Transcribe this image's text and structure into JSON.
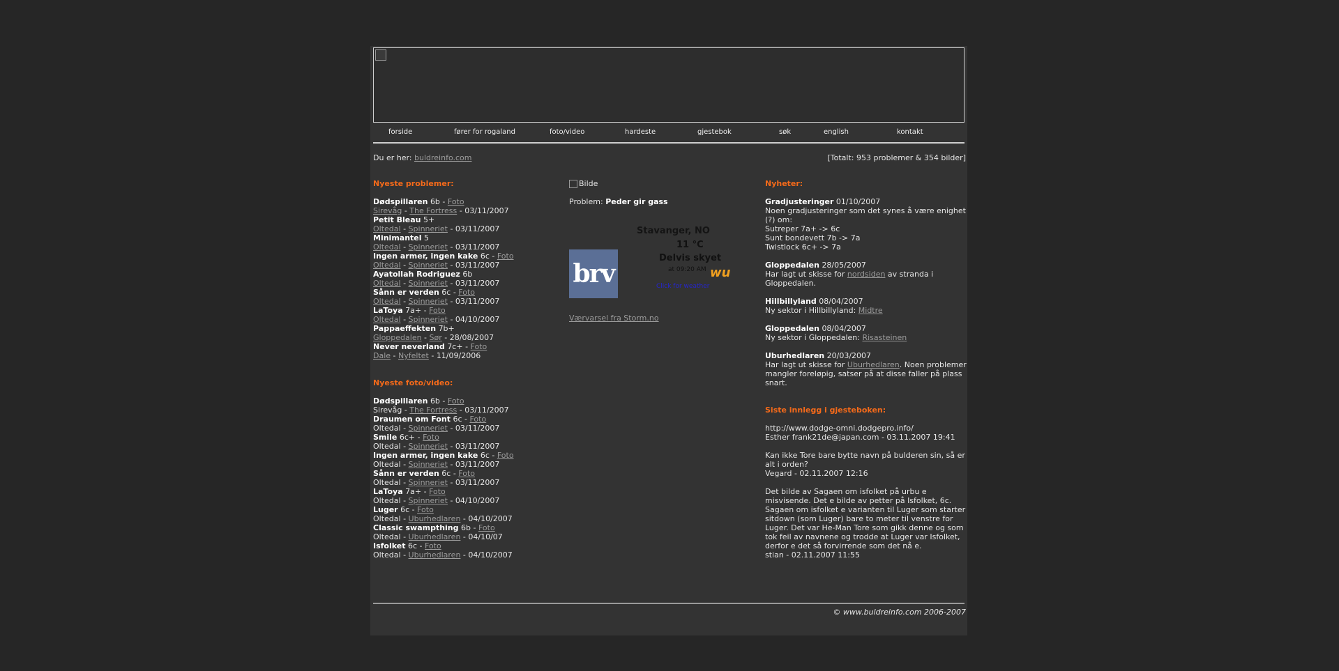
{
  "nav": [
    "forside",
    "fører for rogaland",
    "foto/video",
    "hardeste",
    "gjestebok",
    "søk",
    "english",
    "kontakt"
  ],
  "breadcrumb": {
    "prefix": "Du er her:",
    "link": "buldreinfo.com"
  },
  "totals": "[Totalt: 953 problemer & 354 bilder]",
  "newest_problems": {
    "heading": "Nyeste problemer:",
    "items": [
      {
        "name": "Dødspillaren",
        "grade": "6b",
        "foto": "Foto",
        "area": "Sirevåg",
        "sector": "The Fortress",
        "date": "03/11/2007"
      },
      {
        "name": "Petit Bleau",
        "grade": "5+",
        "foto": "",
        "area": "Oltedal",
        "sector": "Spinneriet",
        "date": "03/11/2007"
      },
      {
        "name": "Minimantel",
        "grade": "5",
        "foto": "",
        "area": "Oltedal",
        "sector": "Spinneriet",
        "date": "03/11/2007"
      },
      {
        "name": "Ingen armer, ingen kake",
        "grade": "6c",
        "foto": "Foto",
        "area": "Oltedal",
        "sector": "Spinneriet",
        "date": "03/11/2007"
      },
      {
        "name": "Ayatollah Rodriguez",
        "grade": "6b",
        "foto": "",
        "area": "Oltedal",
        "sector": "Spinneriet",
        "date": "03/11/2007"
      },
      {
        "name": "Sånn er verden",
        "grade": "6c",
        "foto": "Foto",
        "area": "Oltedal",
        "sector": "Spinneriet",
        "date": "03/11/2007"
      },
      {
        "name": "LaToya",
        "grade": "7a+",
        "foto": "Foto",
        "area": "Oltedal",
        "sector": "Spinneriet",
        "date": "04/10/2007"
      },
      {
        "name": "Pappaeffekten",
        "grade": "7b+",
        "foto": "",
        "area": "Gloppedalen",
        "sector": "Sør",
        "date": "28/08/2007"
      },
      {
        "name": "Never neverland",
        "grade": "7c+",
        "foto": "Foto",
        "area": "Dale",
        "sector": "Nyfeltet",
        "date": "11/09/2006"
      }
    ]
  },
  "newest_media": {
    "heading": "Nyeste foto/video:",
    "items": [
      {
        "name": "Dødspillaren",
        "grade": "6b",
        "foto": "Foto",
        "area": "Sirevåg",
        "sector": "The Fortress",
        "date": "03/11/2007"
      },
      {
        "name": "Draumen om Font",
        "grade": "6c",
        "foto": "Foto",
        "area": "Oltedal",
        "sector": "Spinneriet",
        "date": "03/11/2007"
      },
      {
        "name": "Smile",
        "grade": "6c+",
        "foto": "Foto",
        "area": "Oltedal",
        "sector": "Spinneriet",
        "date": "03/11/2007"
      },
      {
        "name": "Ingen armer, ingen kake",
        "grade": "6c",
        "foto": "Foto",
        "area": "Oltedal",
        "sector": "Spinneriet",
        "date": "03/11/2007"
      },
      {
        "name": "Sånn er verden",
        "grade": "6c",
        "foto": "Foto",
        "area": "Oltedal",
        "sector": "Spinneriet",
        "date": "03/11/2007"
      },
      {
        "name": "LaToya",
        "grade": "7a+",
        "foto": "Foto",
        "area": "Oltedal",
        "sector": "Spinneriet",
        "date": "04/10/2007"
      },
      {
        "name": "Luger",
        "grade": "6c",
        "foto": "Foto",
        "area": "Oltedal",
        "sector": "Uburhedlaren",
        "date": "04/10/2007"
      },
      {
        "name": "Classic swampthing",
        "grade": "6b",
        "foto": "Foto",
        "area": "Oltedal",
        "sector": "Uburhedlaren",
        "date": "04/10/07"
      },
      {
        "name": "Isfolket",
        "grade": "6c",
        "foto": "Foto",
        "area": "Oltedal",
        "sector": "Uburhedlaren",
        "date": "04/10/2007"
      }
    ]
  },
  "featured": {
    "image_alt": "Bilde",
    "problem_label": "Problem:",
    "problem_name": "Peder gir gass"
  },
  "weather": {
    "brv_logo": "brv",
    "city": "Stavanger, NO",
    "temp": "11 °C",
    "condition": "Delvis skyet",
    "time": "at 09:20 AM",
    "logo": "wu",
    "link": "Click for weather",
    "storm_link": "Værvarsel fra Storm.no"
  },
  "news": {
    "heading": "Nyheter:",
    "items": [
      {
        "title": "Gradjusteringer",
        "date": "01/10/2007",
        "lines": [
          "Noen gradjusteringer som det synes å være enighet (?) om:",
          "Sutreper 7a+ -> 6c",
          "Sunt bondevett 7b -> 7a",
          "Twistlock 6c+ -> 7a"
        ]
      },
      {
        "title": "Gloppedalen",
        "date": "28/05/2007",
        "pre": "Har lagt ut skisse for ",
        "link": "nordsiden",
        "post": " av stranda i Gloppedalen."
      },
      {
        "title": "Hillbillyland",
        "date": "08/04/2007",
        "pre": "Ny sektor i Hillbillyland: ",
        "link": "Midtre",
        "post": ""
      },
      {
        "title": "Gloppedalen",
        "date": "08/04/2007",
        "pre": "Ny sektor i Gloppedalen: ",
        "link": "Risasteinen",
        "post": ""
      },
      {
        "title": "Uburhedlaren",
        "date": "20/03/2007",
        "pre": "Har lagt ut skisse for ",
        "link": "Uburhedlaren",
        "post": ". Noen problemer mangler foreløpig, satser på at disse faller på plass snart."
      }
    ]
  },
  "guestbook": {
    "heading": "Siste innlegg i gjesteboken:",
    "items": [
      {
        "text": "http://www.dodge-omni.dodgepro.info/",
        "sig": "Esther frank21de@japan.com - 03.11.2007 19:41"
      },
      {
        "text": "Kan ikke Tore bare bytte navn på bulderen sin, så er alt i orden?",
        "sig": "Vegard - 02.11.2007 12:16"
      },
      {
        "text": "Det bilde av Sagaen om isfolket på urbu e misvisende. Det e bilde av petter på Isfolket, 6c. Sagaen om isfolket e varianten til Luger som starter sitdown (som Luger) bare to meter til venstre for Luger. Det var He-Man Tore som gikk denne og som tok feil av navnene og trodde at Luger var Isfolket, derfor e det så forvirrende som det nå e.",
        "sig": "stian - 02.11.2007 11:55"
      }
    ]
  },
  "footer": "© www.buldreinfo.com 2006-2007"
}
